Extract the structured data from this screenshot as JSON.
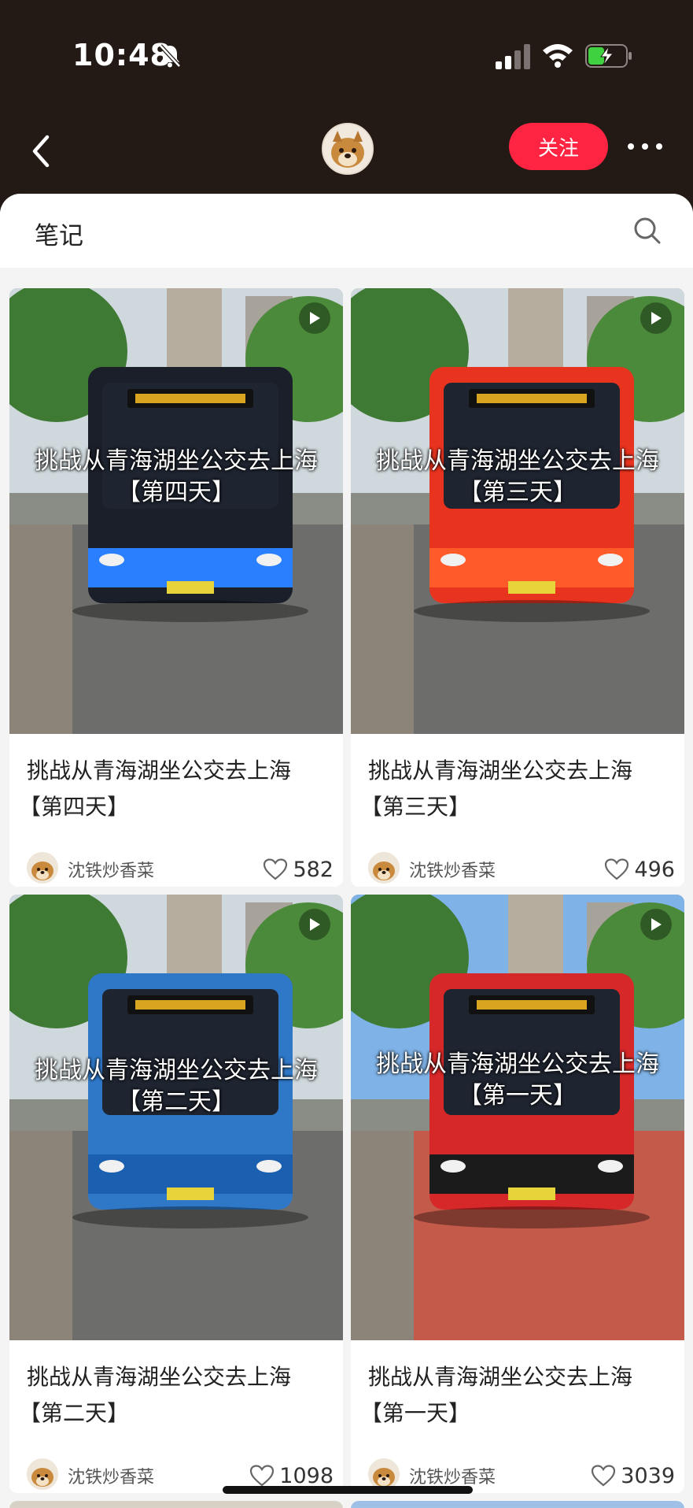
{
  "status": {
    "time": "10:48"
  },
  "header": {
    "follow_label": "关注"
  },
  "section": {
    "title": "笔记"
  },
  "notes": [
    {
      "overlay_title": "挑战从青海湖坐公交去上海",
      "overlay_sub": "【第四天】",
      "title_line1": "挑战从青海湖坐公交去上海",
      "title_line2": "【第四天】",
      "author": "沈铁炒香菜",
      "likes": "582",
      "bus_color": "#1b1f2a",
      "accent": "#2a7fff"
    },
    {
      "overlay_title": "挑战从青海湖坐公交去上海",
      "overlay_sub": "【第三天】",
      "title_line1": "挑战从青海湖坐公交去上海",
      "title_line2": "【第三天】",
      "author": "沈铁炒香菜",
      "likes": "496",
      "bus_color": "#e8331f",
      "accent": "#ff5a2a"
    },
    {
      "overlay_title": "挑战从青海湖坐公交去上海",
      "overlay_sub": "【第二天】",
      "title_line1": "挑战从青海湖坐公交去上海",
      "title_line2": "【第二天】",
      "author": "沈铁炒香菜",
      "likes": "1098",
      "bus_color": "#2f78c8",
      "accent": "#1a5fb0"
    },
    {
      "overlay_title": "挑战从青海湖坐公交去上海",
      "overlay_sub": "【第一天】",
      "title_line1": "挑战从青海湖坐公交去上海",
      "title_line2": "【第一天】",
      "author": "沈铁炒香菜",
      "likes": "3039",
      "bus_color": "#d62828",
      "accent": "#1b1b1b"
    }
  ]
}
